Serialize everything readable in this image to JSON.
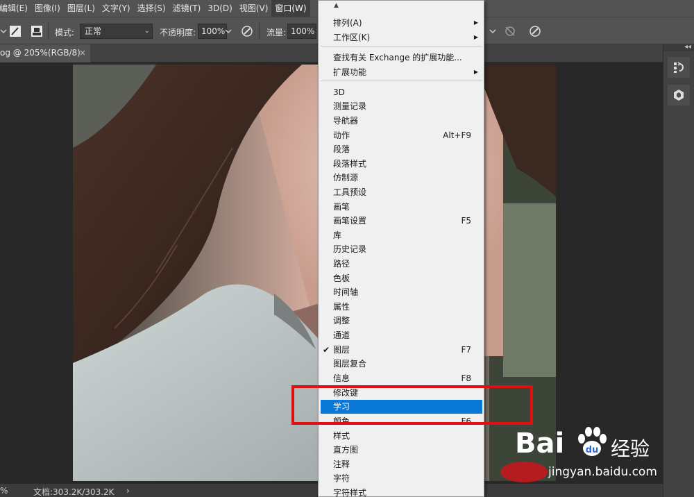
{
  "menubar": {
    "items": [
      "编辑(E)",
      "图像(I)",
      "图层(L)",
      "文字(Y)",
      "选择(S)",
      "滤镜(T)",
      "3D(D)",
      "视图(V)",
      "窗口(W)"
    ]
  },
  "options": {
    "mode_label": "模式:",
    "mode_value": "正常",
    "opacity_label": "不透明度:",
    "opacity_value": "100%",
    "flow_label": "流量:",
    "flow_value": "100%"
  },
  "document": {
    "tab_title": "og @ 205%(RGB/8)",
    "tab_close": "×"
  },
  "status": {
    "zoom": "%",
    "doc_info": "文档:303.2K/303.2K",
    "arrow": "›"
  },
  "panel": {
    "collapse": "◂◂"
  },
  "window_menu": {
    "top_arrow": "▲",
    "items": [
      {
        "label": "排列(A)",
        "submenu": true
      },
      {
        "label": "工作区(K)",
        "submenu": true
      },
      {
        "label": "查找有关 Exchange 的扩展功能..."
      },
      {
        "label": "扩展功能",
        "submenu": true
      },
      {
        "label": "3D"
      },
      {
        "label": "测量记录"
      },
      {
        "label": "导航器"
      },
      {
        "label": "动作",
        "shortcut": "Alt+F9"
      },
      {
        "label": "段落"
      },
      {
        "label": "段落样式"
      },
      {
        "label": "仿制源"
      },
      {
        "label": "工具预设"
      },
      {
        "label": "画笔"
      },
      {
        "label": "画笔设置",
        "shortcut": "F5"
      },
      {
        "label": "库"
      },
      {
        "label": "历史记录"
      },
      {
        "label": "路径"
      },
      {
        "label": "色板"
      },
      {
        "label": "时间轴"
      },
      {
        "label": "属性"
      },
      {
        "label": "调整"
      },
      {
        "label": "通道"
      },
      {
        "label": "图层",
        "shortcut": "F7",
        "checked": true
      },
      {
        "label": "图层复合"
      },
      {
        "label": "信息",
        "shortcut": "F8"
      },
      {
        "label": "修改键"
      },
      {
        "label": "学习",
        "highlighted": true
      },
      {
        "label": "颜色",
        "shortcut": "F6"
      },
      {
        "label": "样式"
      },
      {
        "label": "直方图"
      },
      {
        "label": "注释"
      },
      {
        "label": "字符"
      },
      {
        "label": "字符样式"
      }
    ]
  },
  "watermark": {
    "brand": "Bai",
    "brand2": "du",
    "jingyan": "经验",
    "url": "jingyan.baidu.com"
  },
  "colors": {
    "menu_highlight": "#0a78d7",
    "annotation_box": "#e01010"
  }
}
